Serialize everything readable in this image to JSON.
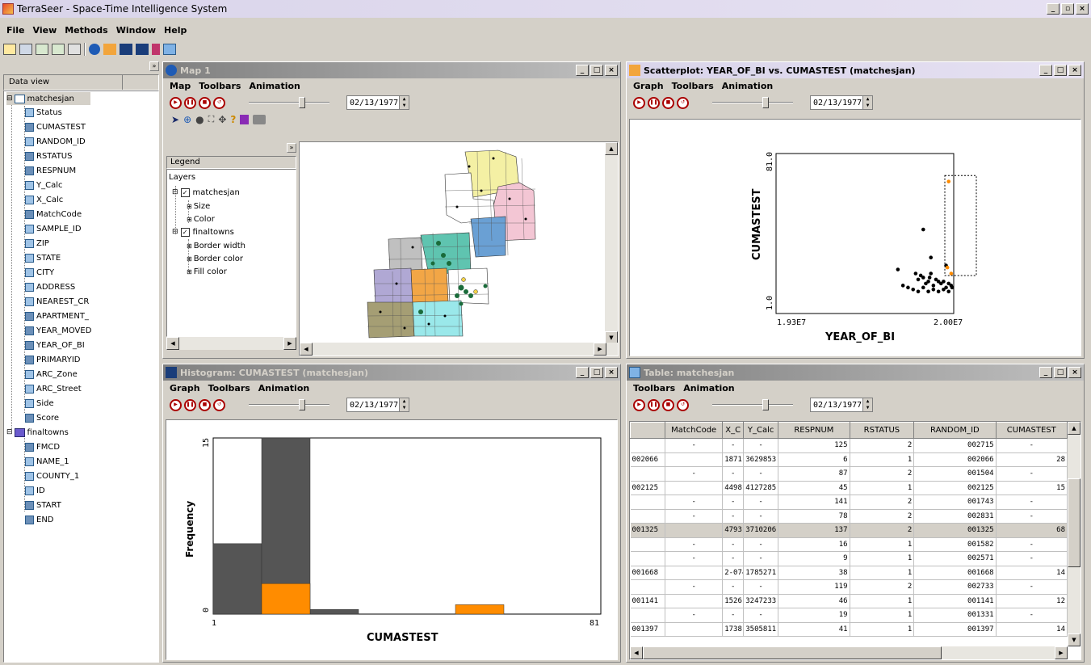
{
  "app": {
    "title": "TerraSeer - Space-Time Intelligence System",
    "menus": [
      "File",
      "View",
      "Methods",
      "Window",
      "Help"
    ]
  },
  "data_view": {
    "label": "Data view",
    "root": "matchesjan",
    "fields": [
      "Status",
      "CUMASTEST",
      "RANDOM_ID",
      "RSTATUS",
      "RESPNUM",
      "Y_Calc",
      "X_Calc",
      "MatchCode",
      "SAMPLE_ID",
      "ZIP",
      "STATE",
      "CITY",
      "ADDRESS",
      "NEAREST_CR",
      "APARTMENT_",
      "YEAR_MOVED",
      "YEAR_OF_BI",
      "PRIMARYID",
      "ARC_Zone",
      "ARC_Street",
      "Side",
      "Score"
    ],
    "root2": "finaltowns",
    "fields2": [
      "FMCD",
      "NAME_1",
      "COUNTY_1",
      "ID",
      "START",
      "END"
    ]
  },
  "map": {
    "title": "Map 1",
    "menus": [
      "Map",
      "Toolbars",
      "Animation"
    ],
    "date": "02/13/1977",
    "legend_title": "Legend",
    "layers_label": "Layers",
    "layer1": "matchesjan",
    "layer1_children": [
      "Size",
      "Color"
    ],
    "layer2": "finaltowns",
    "layer2_children": [
      "Border width",
      "Border color",
      "Fill color"
    ]
  },
  "scatter": {
    "title": "Scatterplot: YEAR_OF_BI vs. CUMASTEST (matchesjan)",
    "menus": [
      "Graph",
      "Toolbars",
      "Animation"
    ],
    "date": "02/13/1977",
    "xlabel": "YEAR_OF_BI",
    "ylabel": "CUMASTEST",
    "x_ticks": [
      "1.93E7",
      "2.00E7"
    ],
    "y_ticks": [
      "81.0",
      "1.0"
    ]
  },
  "histogram": {
    "title": "Histogram: CUMASTEST (matchesjan)",
    "menus": [
      "Graph",
      "Toolbars",
      "Animation"
    ],
    "date": "02/13/1977",
    "xlabel": "CUMASTEST",
    "ylabel": "Frequency",
    "x_ticks": [
      "1",
      "81"
    ],
    "y_ticks": [
      "15",
      "0"
    ]
  },
  "table": {
    "title": "Table: matchesjan",
    "menus": [
      "Toolbars",
      "Animation"
    ],
    "date": "02/13/1977",
    "columns": [
      "",
      "MatchCode",
      "X_C",
      "Y_Calc",
      "RESPNUM",
      "RSTATUS",
      "RANDOM_ID",
      "CUMASTEST"
    ],
    "rows": [
      [
        "",
        "-",
        "-",
        "-",
        "125",
        "2",
        "002715",
        "-"
      ],
      [
        "002066",
        "",
        "1871",
        "3629853",
        "6",
        "1",
        "002066",
        "28"
      ],
      [
        "",
        "-",
        "-",
        "-",
        "87",
        "2",
        "001504",
        "-"
      ],
      [
        "002125",
        "",
        "4498",
        "4127285",
        "45",
        "1",
        "002125",
        "15"
      ],
      [
        "",
        "-",
        "-",
        "-",
        "141",
        "2",
        "001743",
        "-"
      ],
      [
        "",
        "-",
        "-",
        "-",
        "78",
        "2",
        "002831",
        "-"
      ],
      [
        "001325",
        "",
        "4793",
        "3710206",
        "137",
        "2",
        "001325",
        "68"
      ],
      [
        "",
        "-",
        "-",
        "-",
        "16",
        "1",
        "001582",
        "-"
      ],
      [
        "",
        "-",
        "-",
        "-",
        "9",
        "1",
        "002571",
        "-"
      ],
      [
        "001668",
        "",
        "2-0741",
        "1785271",
        "38",
        "1",
        "001668",
        "14"
      ],
      [
        "",
        "-",
        "-",
        "-",
        "119",
        "2",
        "002733",
        "-"
      ],
      [
        "001141",
        "",
        "1526",
        "3247233",
        "46",
        "1",
        "001141",
        "12"
      ],
      [
        "",
        "-",
        "-",
        "-",
        "19",
        "1",
        "001331",
        "-"
      ],
      [
        "001397",
        "",
        "1738",
        "3505811",
        "41",
        "1",
        "001397",
        "14"
      ]
    ]
  },
  "chart_data": [
    {
      "type": "scatter",
      "xlabel": "YEAR_OF_BI",
      "ylabel": "CUMASTEST",
      "xlim": [
        19300000,
        20000000
      ],
      "ylim": [
        1,
        81
      ],
      "x_ticks": [
        "1.93E7",
        "2.00E7"
      ],
      "y_ticks": [
        "1.0",
        "81.0"
      ],
      "series": [
        {
          "color": "#000000",
          "points": [
            [
              19780000,
              23
            ],
            [
              19880000,
              43
            ],
            [
              19850000,
              21
            ],
            [
              19860000,
              18
            ],
            [
              19870000,
              20
            ],
            [
              19880000,
              19
            ],
            [
              19890000,
              16
            ],
            [
              19900000,
              17
            ],
            [
              19905000,
              19
            ],
            [
              19910000,
              21
            ],
            [
              19920000,
              15
            ],
            [
              19930000,
              18
            ],
            [
              19940000,
              17
            ],
            [
              19950000,
              16
            ],
            [
              19960000,
              17
            ],
            [
              19970000,
              14
            ],
            [
              19980000,
              16
            ],
            [
              19990000,
              15
            ],
            [
              20000000,
              14
            ],
            [
              19800000,
              15
            ],
            [
              19820000,
              14
            ],
            [
              19840000,
              13
            ],
            [
              19860000,
              12
            ],
            [
              19880000,
              14
            ],
            [
              19900000,
              12
            ],
            [
              19920000,
              13
            ],
            [
              19940000,
              12
            ],
            [
              19960000,
              13
            ],
            [
              19980000,
              12
            ],
            [
              19910000,
              29
            ],
            [
              19970000,
              25
            ]
          ]
        },
        {
          "color": "#ff8c00",
          "points": [
            [
              19980000,
              67
            ],
            [
              19975000,
              24
            ],
            [
              19990000,
              21
            ]
          ]
        }
      ],
      "selection_box": {
        "x": [
          19965000,
          20100000
        ],
        "y": [
          20,
          70
        ]
      }
    },
    {
      "type": "bar",
      "xlabel": "CUMASTEST",
      "ylabel": "Frequency",
      "xlim": [
        1,
        81
      ],
      "ylim": [
        0,
        15
      ],
      "x_ticks": [
        "1",
        "81"
      ],
      "y_ticks": [
        "0",
        "15"
      ],
      "bins": [
        [
          1,
          11
        ],
        [
          11,
          21
        ],
        [
          21,
          31
        ],
        [
          31,
          41
        ],
        [
          41,
          51
        ],
        [
          51,
          61
        ],
        [
          61,
          71
        ],
        [
          71,
          81
        ]
      ],
      "series": [
        {
          "color": "#555555",
          "values": [
            6,
            15,
            0.4,
            0,
            0,
            0,
            0,
            0
          ]
        },
        {
          "color": "#ff8c00",
          "values": [
            0,
            2.6,
            0,
            0,
            0,
            0.8,
            0,
            0
          ]
        }
      ]
    }
  ]
}
